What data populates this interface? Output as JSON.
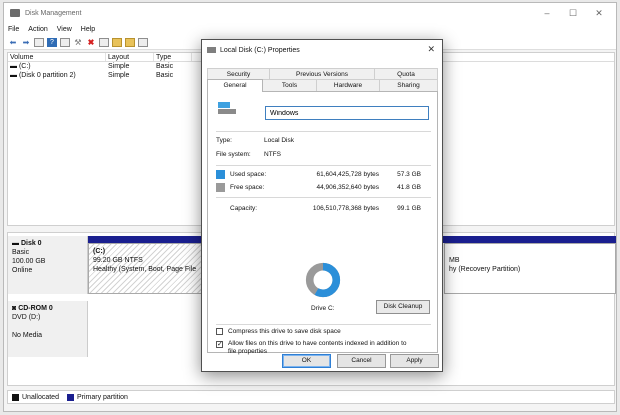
{
  "app": {
    "title": "Disk Management",
    "controls": {
      "minimize": "–",
      "maximize": "☐",
      "close": "✕"
    }
  },
  "menu": [
    "File",
    "Action",
    "View",
    "Help"
  ],
  "volume_table": {
    "headers": [
      "Volume",
      "Layout",
      "Type"
    ],
    "rows": [
      {
        "volume": "(C:)",
        "layout": "Simple",
        "type": "Basic"
      },
      {
        "volume": "(Disk 0 partition 2)",
        "layout": "Simple",
        "type": "Basic"
      }
    ]
  },
  "disks": [
    {
      "name": "Disk 0",
      "kind": "Basic",
      "size": "100.00 GB",
      "status": "Online",
      "partitions": [
        {
          "name": "(C:)",
          "size": "99.20 GB NTFS",
          "status": "Healthy (System, Boot, Page File"
        },
        {
          "size": "MB",
          "status": "hy (Recovery Partition)"
        }
      ]
    },
    {
      "name": "CD-ROM 0",
      "kind": "DVD (D:)",
      "status": "No Media"
    }
  ],
  "legend": [
    {
      "label": "Unallocated",
      "color": "#111111"
    },
    {
      "label": "Primary partition",
      "color": "#1a1f8f"
    }
  ],
  "dialog": {
    "title": "Local Disk (C:) Properties",
    "close": "✕",
    "tabs_row1": [
      "Security",
      "Previous Versions",
      "Quota"
    ],
    "tabs_row2": [
      "General",
      "Tools",
      "Hardware",
      "Sharing"
    ],
    "active_tab": "General",
    "name_value": "Windows",
    "type_label": "Type:",
    "type_value": "Local Disk",
    "fs_label": "File system:",
    "fs_value": "NTFS",
    "used_label": "Used space:",
    "used_bytes": "61,604,425,728 bytes",
    "used_gb": "57.3 GB",
    "free_label": "Free space:",
    "free_bytes": "44,906,352,640 bytes",
    "free_gb": "41.8 GB",
    "capacity_label": "Capacity:",
    "capacity_bytes": "106,510,778,368 bytes",
    "capacity_gb": "99.1 GB",
    "used_fraction": 0.578,
    "used_color": "#2b8fd9",
    "free_color": "#9a9a9a",
    "drive_label": "Drive C:",
    "cleanup_button": "Disk Cleanup",
    "compress_label": "Compress this drive to save disk space",
    "compress_checked": false,
    "index_label_line1": "Allow files on this drive to have contents indexed in addition to",
    "index_label_line2": "file properties",
    "index_checked": true,
    "ok": "OK",
    "cancel": "Cancel",
    "apply": "Apply"
  }
}
